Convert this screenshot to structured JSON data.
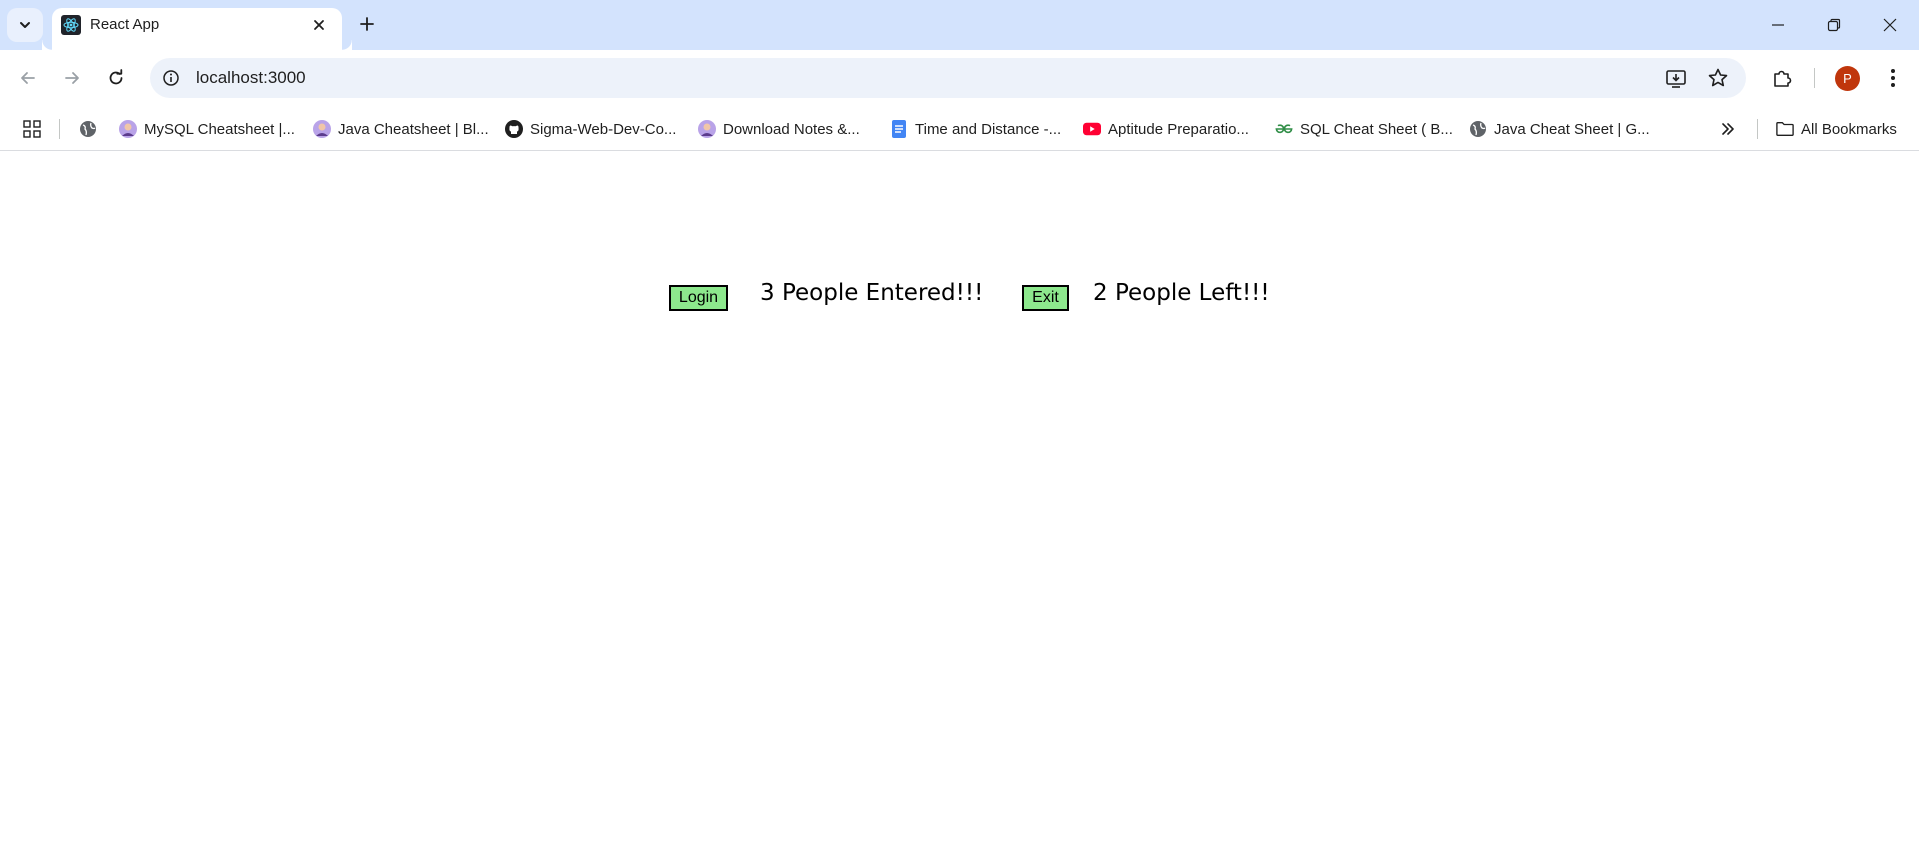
{
  "browser": {
    "tab": {
      "title": "React App"
    },
    "omnibox": {
      "url": "localhost:3000"
    },
    "profile": {
      "initial": "P"
    },
    "bookmarks": [
      {
        "label": "MySQL Cheatsheet |...",
        "icon": "avatar-icon"
      },
      {
        "label": "Java Cheatsheet | Bl...",
        "icon": "avatar-icon"
      },
      {
        "label": "Sigma-Web-Dev-Co...",
        "icon": "github-icon"
      },
      {
        "label": "Download Notes &...",
        "icon": "avatar-icon"
      },
      {
        "label": "Time and Distance -...",
        "icon": "docs-icon"
      },
      {
        "label": "Aptitude Preparatio...",
        "icon": "youtube-icon"
      },
      {
        "label": "SQL Cheat Sheet ( B...",
        "icon": "gfg-icon"
      },
      {
        "label": "Java Cheat Sheet | G...",
        "icon": "globe-icon"
      }
    ],
    "all_bookmarks_label": "All Bookmarks"
  },
  "app": {
    "login_label": "Login",
    "entered_text": "3 People Entered!!!",
    "exit_label": "Exit",
    "left_text": "2 People Left!!!"
  },
  "colors": {
    "tabstrip": "#d3e3fd",
    "omnibox": "#edf2fa",
    "button_green": "#8de88d",
    "avatar": "#c0360c"
  }
}
